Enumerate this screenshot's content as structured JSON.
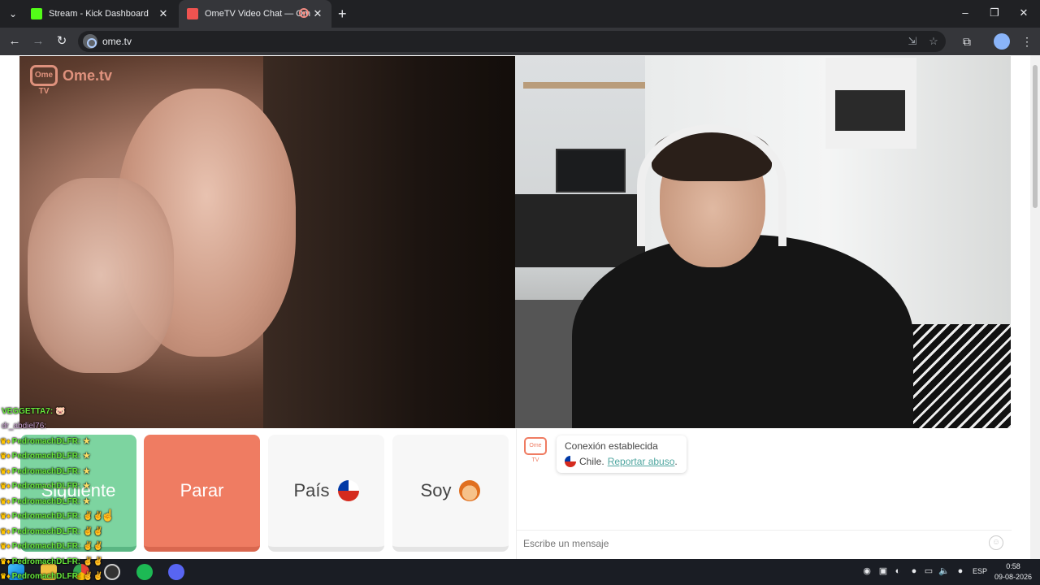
{
  "browser": {
    "tabs": [
      {
        "title": "Stream - Kick Dashboard",
        "favicon_color": "#53fc18"
      },
      {
        "title": "OmeTV Video Chat — Ome",
        "favicon_color": "#ef5350"
      }
    ],
    "new_tab_icon": "plus-icon",
    "url": "ome.tv",
    "window_controls": {
      "minimize": "–",
      "restore": "❐",
      "close": "✕"
    }
  },
  "site": {
    "logo_text": "Ome.tv",
    "logo_badge": "Ome TV"
  },
  "buttons": {
    "next": "Siguiente",
    "stop": "Parar",
    "country": "País",
    "me": "Soy"
  },
  "chat": {
    "status": "Conexión establecida",
    "country": "Chile.",
    "report_link": "Reportar abuso",
    "report_suffix": ".",
    "input_placeholder": "Escribe un mensaje",
    "logo_badge": "Ome TV"
  },
  "stream_overlay": {
    "messages": [
      {
        "user": "VEGGETTA7:",
        "msg": "🐷",
        "badges": ""
      },
      {
        "user": "dr_abdiel76:",
        "msg": "",
        "badges": ""
      },
      {
        "user": "PedromachDLFR:",
        "msg": "★",
        "badges": "♛♦"
      },
      {
        "user": "PedromachDLFR:",
        "msg": "★",
        "badges": "♛♦"
      },
      {
        "user": "PedromachDLFR:",
        "msg": "★",
        "badges": "♛♦"
      },
      {
        "user": "PedromachDLFR:",
        "msg": "★",
        "badges": "♛♦"
      },
      {
        "user": "PedromachDLFR:",
        "msg": "★",
        "badges": "♛♦"
      },
      {
        "user": "PedromachDLFR:",
        "msg": "✌✌",
        "badges": "♛♦"
      },
      {
        "user": "PedromachDLFR:",
        "msg": "✌✌",
        "badges": "♛♦"
      },
      {
        "user": "PedromachDLFR:",
        "msg": "✌✌",
        "badges": "♛♦"
      },
      {
        "user": "PedromachDLFR:",
        "msg": "✌✌",
        "badges": "♛♦"
      },
      {
        "user": "PedromachDLFR:",
        "msg": "✌✌",
        "badges": "♛♦"
      }
    ]
  },
  "taskbar": {
    "language": "ESP",
    "time": "0:58",
    "date": "09-08-2026"
  }
}
